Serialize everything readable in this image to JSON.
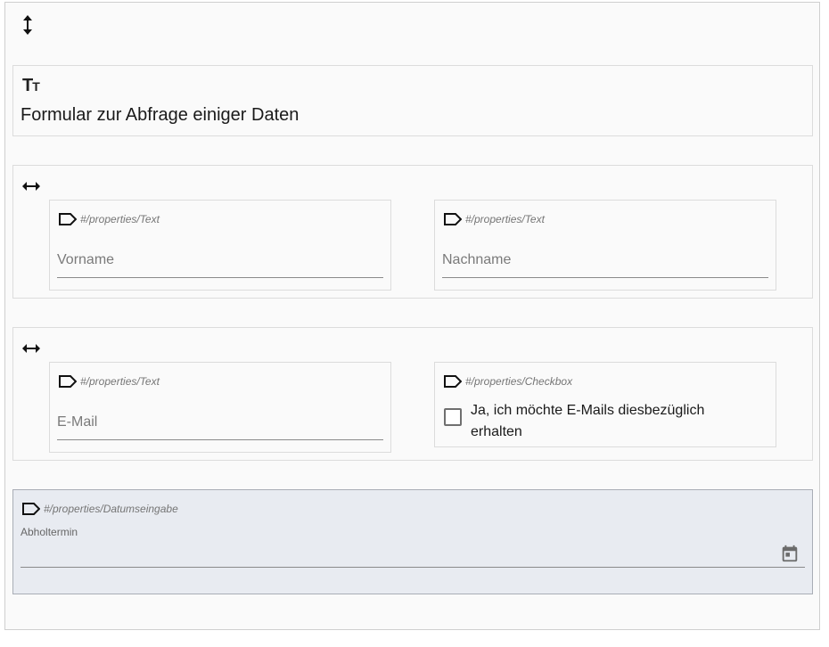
{
  "icons": {
    "vertical_layout": "vertical-arrow-icon",
    "horizontal_layout": "horizontal-arrow-icon",
    "label_element": "text-size-icon",
    "scope_tag": "tag-icon",
    "calendar": "calendar-icon"
  },
  "label_element": {
    "icon_text": "Tт",
    "text": "Formular zur Abfrage einiger Daten"
  },
  "row1": {
    "left": {
      "scope": "#/properties/Text",
      "placeholder": "Vorname",
      "value": ""
    },
    "right": {
      "scope": "#/properties/Text",
      "placeholder": "Nachname",
      "value": ""
    }
  },
  "row2": {
    "left": {
      "scope": "#/properties/Text",
      "placeholder": "E-Mail",
      "value": ""
    },
    "right": {
      "scope": "#/properties/Checkbox",
      "label": "Ja, ich möchte E-Mails diesbezüglich erhalten",
      "checked": false
    }
  },
  "date": {
    "scope": "#/properties/Datumseingabe",
    "label": "Abholtermin",
    "value": ""
  },
  "colors": {
    "border": "#dcdcdc",
    "selected_bg": "#e8ebf1",
    "muted_text": "#757575"
  }
}
